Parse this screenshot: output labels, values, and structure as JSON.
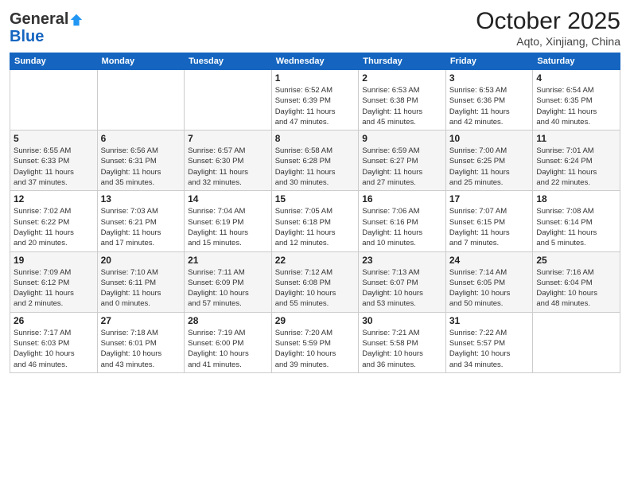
{
  "header": {
    "logo_general": "General",
    "logo_blue": "Blue",
    "month_title": "October 2025",
    "location": "Aqto, Xinjiang, China"
  },
  "weekdays": [
    "Sunday",
    "Monday",
    "Tuesday",
    "Wednesday",
    "Thursday",
    "Friday",
    "Saturday"
  ],
  "weeks": [
    [
      {
        "day": "",
        "info": ""
      },
      {
        "day": "",
        "info": ""
      },
      {
        "day": "",
        "info": ""
      },
      {
        "day": "1",
        "info": "Sunrise: 6:52 AM\nSunset: 6:39 PM\nDaylight: 11 hours\nand 47 minutes."
      },
      {
        "day": "2",
        "info": "Sunrise: 6:53 AM\nSunset: 6:38 PM\nDaylight: 11 hours\nand 45 minutes."
      },
      {
        "day": "3",
        "info": "Sunrise: 6:53 AM\nSunset: 6:36 PM\nDaylight: 11 hours\nand 42 minutes."
      },
      {
        "day": "4",
        "info": "Sunrise: 6:54 AM\nSunset: 6:35 PM\nDaylight: 11 hours\nand 40 minutes."
      }
    ],
    [
      {
        "day": "5",
        "info": "Sunrise: 6:55 AM\nSunset: 6:33 PM\nDaylight: 11 hours\nand 37 minutes."
      },
      {
        "day": "6",
        "info": "Sunrise: 6:56 AM\nSunset: 6:31 PM\nDaylight: 11 hours\nand 35 minutes."
      },
      {
        "day": "7",
        "info": "Sunrise: 6:57 AM\nSunset: 6:30 PM\nDaylight: 11 hours\nand 32 minutes."
      },
      {
        "day": "8",
        "info": "Sunrise: 6:58 AM\nSunset: 6:28 PM\nDaylight: 11 hours\nand 30 minutes."
      },
      {
        "day": "9",
        "info": "Sunrise: 6:59 AM\nSunset: 6:27 PM\nDaylight: 11 hours\nand 27 minutes."
      },
      {
        "day": "10",
        "info": "Sunrise: 7:00 AM\nSunset: 6:25 PM\nDaylight: 11 hours\nand 25 minutes."
      },
      {
        "day": "11",
        "info": "Sunrise: 7:01 AM\nSunset: 6:24 PM\nDaylight: 11 hours\nand 22 minutes."
      }
    ],
    [
      {
        "day": "12",
        "info": "Sunrise: 7:02 AM\nSunset: 6:22 PM\nDaylight: 11 hours\nand 20 minutes."
      },
      {
        "day": "13",
        "info": "Sunrise: 7:03 AM\nSunset: 6:21 PM\nDaylight: 11 hours\nand 17 minutes."
      },
      {
        "day": "14",
        "info": "Sunrise: 7:04 AM\nSunset: 6:19 PM\nDaylight: 11 hours\nand 15 minutes."
      },
      {
        "day": "15",
        "info": "Sunrise: 7:05 AM\nSunset: 6:18 PM\nDaylight: 11 hours\nand 12 minutes."
      },
      {
        "day": "16",
        "info": "Sunrise: 7:06 AM\nSunset: 6:16 PM\nDaylight: 11 hours\nand 10 minutes."
      },
      {
        "day": "17",
        "info": "Sunrise: 7:07 AM\nSunset: 6:15 PM\nDaylight: 11 hours\nand 7 minutes."
      },
      {
        "day": "18",
        "info": "Sunrise: 7:08 AM\nSunset: 6:14 PM\nDaylight: 11 hours\nand 5 minutes."
      }
    ],
    [
      {
        "day": "19",
        "info": "Sunrise: 7:09 AM\nSunset: 6:12 PM\nDaylight: 11 hours\nand 2 minutes."
      },
      {
        "day": "20",
        "info": "Sunrise: 7:10 AM\nSunset: 6:11 PM\nDaylight: 11 hours\nand 0 minutes."
      },
      {
        "day": "21",
        "info": "Sunrise: 7:11 AM\nSunset: 6:09 PM\nDaylight: 10 hours\nand 57 minutes."
      },
      {
        "day": "22",
        "info": "Sunrise: 7:12 AM\nSunset: 6:08 PM\nDaylight: 10 hours\nand 55 minutes."
      },
      {
        "day": "23",
        "info": "Sunrise: 7:13 AM\nSunset: 6:07 PM\nDaylight: 10 hours\nand 53 minutes."
      },
      {
        "day": "24",
        "info": "Sunrise: 7:14 AM\nSunset: 6:05 PM\nDaylight: 10 hours\nand 50 minutes."
      },
      {
        "day": "25",
        "info": "Sunrise: 7:16 AM\nSunset: 6:04 PM\nDaylight: 10 hours\nand 48 minutes."
      }
    ],
    [
      {
        "day": "26",
        "info": "Sunrise: 7:17 AM\nSunset: 6:03 PM\nDaylight: 10 hours\nand 46 minutes."
      },
      {
        "day": "27",
        "info": "Sunrise: 7:18 AM\nSunset: 6:01 PM\nDaylight: 10 hours\nand 43 minutes."
      },
      {
        "day": "28",
        "info": "Sunrise: 7:19 AM\nSunset: 6:00 PM\nDaylight: 10 hours\nand 41 minutes."
      },
      {
        "day": "29",
        "info": "Sunrise: 7:20 AM\nSunset: 5:59 PM\nDaylight: 10 hours\nand 39 minutes."
      },
      {
        "day": "30",
        "info": "Sunrise: 7:21 AM\nSunset: 5:58 PM\nDaylight: 10 hours\nand 36 minutes."
      },
      {
        "day": "31",
        "info": "Sunrise: 7:22 AM\nSunset: 5:57 PM\nDaylight: 10 hours\nand 34 minutes."
      },
      {
        "day": "",
        "info": ""
      }
    ]
  ]
}
